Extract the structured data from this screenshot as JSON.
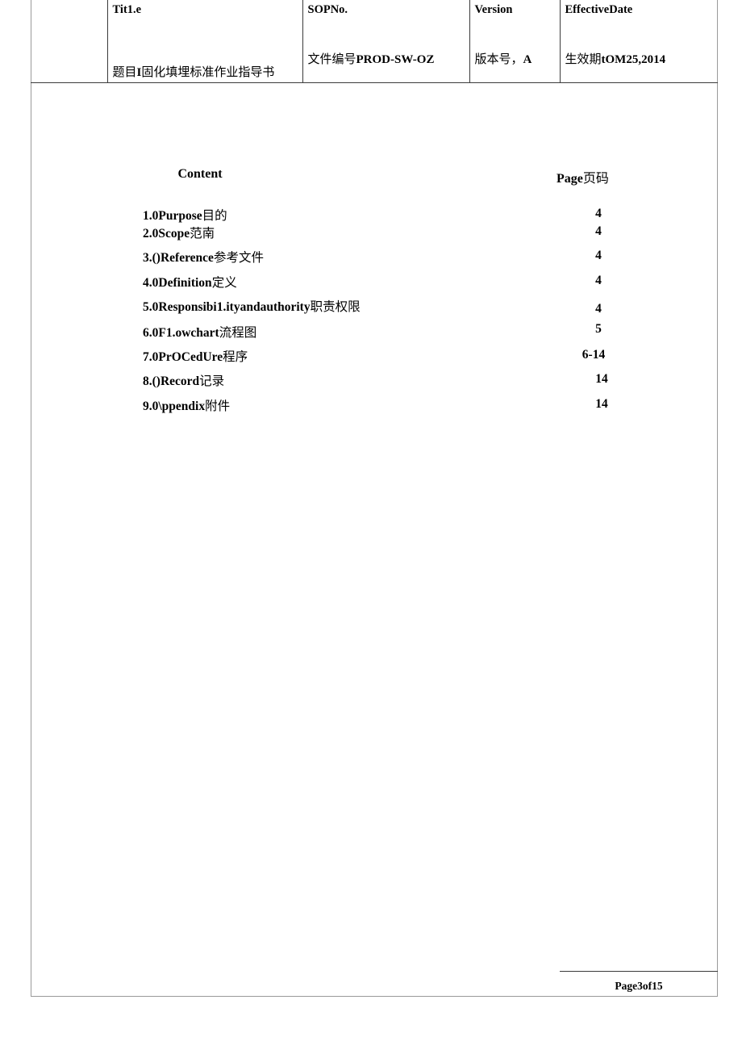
{
  "document": {
    "header": {
      "logo_cell": "",
      "columns": [
        {
          "label": "Tit1.e",
          "value_cn": "题目",
          "value_mark": "I",
          "value_rest": "固化填埋标准作业指导书"
        },
        {
          "label": "SOPNo.",
          "value_cn": "文件编号",
          "value_code": "PROD-SW-OZ"
        },
        {
          "label": "Version",
          "value_cn": "版本号，",
          "value_code": "A"
        },
        {
          "label": "EffectiveDate",
          "value_cn": "生效期",
          "value_code": "tOM25,2014"
        }
      ]
    },
    "toc": {
      "head_content": "Content",
      "head_page_en": "Page",
      "head_page_cn": "页码",
      "items": [
        {
          "num": "1.0",
          "en": "Purpose",
          "cn": "目的",
          "page": "4"
        },
        {
          "num": "2.0",
          "en": "Scope",
          "cn": "范南",
          "page": "4"
        },
        {
          "num": "3.()",
          "en": "Reference",
          "cn": "参考文件",
          "page": "4"
        },
        {
          "num": "4.0",
          "en": "Definition",
          "cn": "定义",
          "page": "4"
        },
        {
          "num": "5.0",
          "en": "Responsibi1.ityandauthority",
          "cn": "职责权限",
          "page": "4"
        },
        {
          "num": "6.0",
          "en": "F1.owchart",
          "cn": "流程图",
          "page": "5"
        },
        {
          "num": "7.0",
          "en": "PrOCedUre",
          "cn": "程序",
          "page": "6-14"
        },
        {
          "num": "8.()",
          "en": "Record",
          "cn": "记录",
          "page": "14"
        },
        {
          "num": "9.0",
          "en": "\\ppendix",
          "cn": "附件",
          "page": "14"
        }
      ]
    },
    "footer": {
      "page_label": "Page3of15"
    }
  }
}
